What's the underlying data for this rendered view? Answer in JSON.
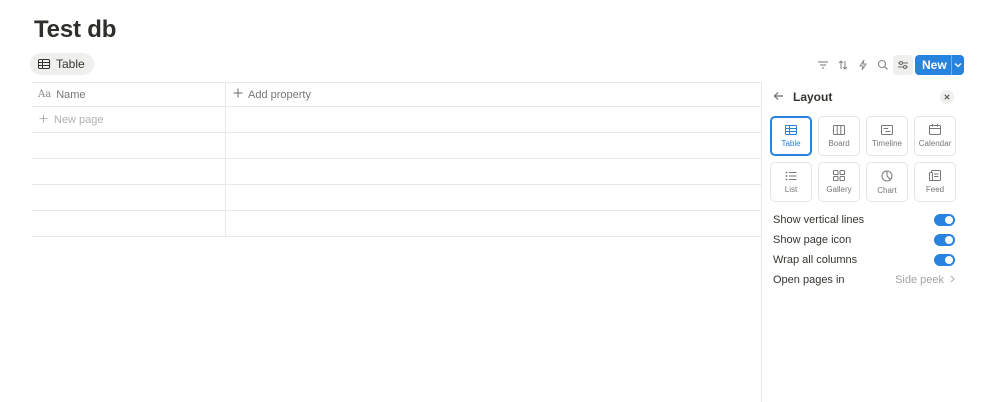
{
  "page": {
    "title": "Test db"
  },
  "view_tab": {
    "label": "Table",
    "icon": "table-icon"
  },
  "toolbar": {
    "icons": [
      "filter-icon",
      "sort-icon",
      "automation-icon",
      "search-icon",
      "settings-sliders-icon"
    ],
    "new_label": "New"
  },
  "table": {
    "columns": [
      {
        "icon": "Aa",
        "label": "Name"
      },
      {
        "icon": "plus-icon",
        "label": "Add property"
      }
    ],
    "new_page_label": "New page",
    "empty_rows": 4
  },
  "layout_panel": {
    "title": "Layout",
    "layouts": [
      {
        "label": "Table",
        "icon": "table-icon",
        "selected": true
      },
      {
        "label": "Board",
        "icon": "board-icon",
        "selected": false
      },
      {
        "label": "Timeline",
        "icon": "timeline-icon",
        "selected": false
      },
      {
        "label": "Calendar",
        "icon": "calendar-icon",
        "selected": false
      },
      {
        "label": "List",
        "icon": "list-icon",
        "selected": false
      },
      {
        "label": "Gallery",
        "icon": "gallery-icon",
        "selected": false
      },
      {
        "label": "Chart",
        "icon": "chart-icon",
        "selected": false
      },
      {
        "label": "Feed",
        "icon": "feed-icon",
        "selected": false
      }
    ],
    "settings": [
      {
        "label": "Show vertical lines",
        "on": true
      },
      {
        "label": "Show page icon",
        "on": true
      },
      {
        "label": "Wrap all columns",
        "on": true
      }
    ],
    "open_pages": {
      "label": "Open pages in",
      "value": "Side peek"
    }
  },
  "colors": {
    "accent": "#2783de",
    "text": "#37352f",
    "muted": "#787774",
    "border": "#e9e9e7"
  }
}
